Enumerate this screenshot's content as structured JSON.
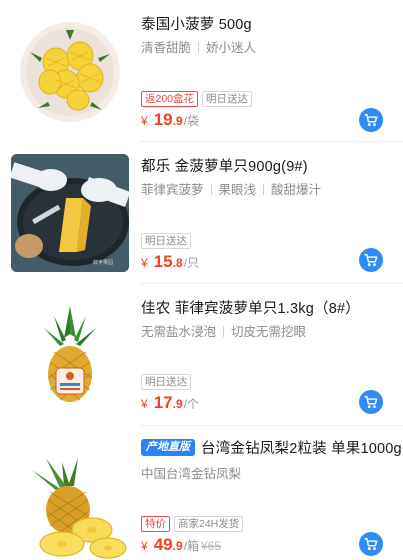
{
  "products": [
    {
      "title": "泰国小菠萝 500g",
      "features": [
        "清香甜脆",
        "娇小迷人"
      ],
      "tags": [
        {
          "text": "返200盒花",
          "style": "red-combo"
        },
        {
          "text": "明日送达",
          "style": "gray"
        }
      ],
      "price_yen": "¥",
      "price_int": "19",
      "price_dec": ".9",
      "price_unit": "/袋",
      "image": "small-pineapples-on-plate"
    },
    {
      "title": "都乐 金菠萝单只900g(9#)",
      "features": [
        "菲律宾菠萝",
        "果眼浅",
        "酸甜爆汁"
      ],
      "tags": [
        {
          "text": "明日送达",
          "style": "gray"
        }
      ],
      "price_yen": "¥",
      "price_int": "15",
      "price_dec": ".8",
      "price_unit": "/只",
      "image": "pineapple-being-cut",
      "image_caption": "鲜丰果园"
    },
    {
      "title": "佳农 菲律宾菠萝单只1.3kg（8#）",
      "features": [
        "无需盐水浸泡",
        "切皮无需挖眼"
      ],
      "tags": [
        {
          "text": "明日送达",
          "style": "gray"
        }
      ],
      "price_yen": "¥",
      "price_int": "17",
      "price_dec": ".9",
      "price_unit": "/个",
      "image": "whole-pineapple"
    },
    {
      "title_badge": "产地直版",
      "title": "台湾金钻凤梨2粒装 单果1000g+",
      "features": [
        "中国台湾金钻凤梨"
      ],
      "tags": [
        {
          "text": "特价",
          "style": "red"
        },
        {
          "text": "商家24H发货",
          "style": "gray"
        }
      ],
      "price_yen": "¥",
      "price_int": "49",
      "price_dec": ".9",
      "price_unit": "/箱",
      "price_original": "¥65",
      "image": "pineapple-with-slices"
    }
  ],
  "colors": {
    "price": "#f4401f",
    "cart_button": "#2f8cf5",
    "promo_badge": "#2a84f5"
  },
  "icons": {
    "cart": "shopping-cart-icon"
  }
}
